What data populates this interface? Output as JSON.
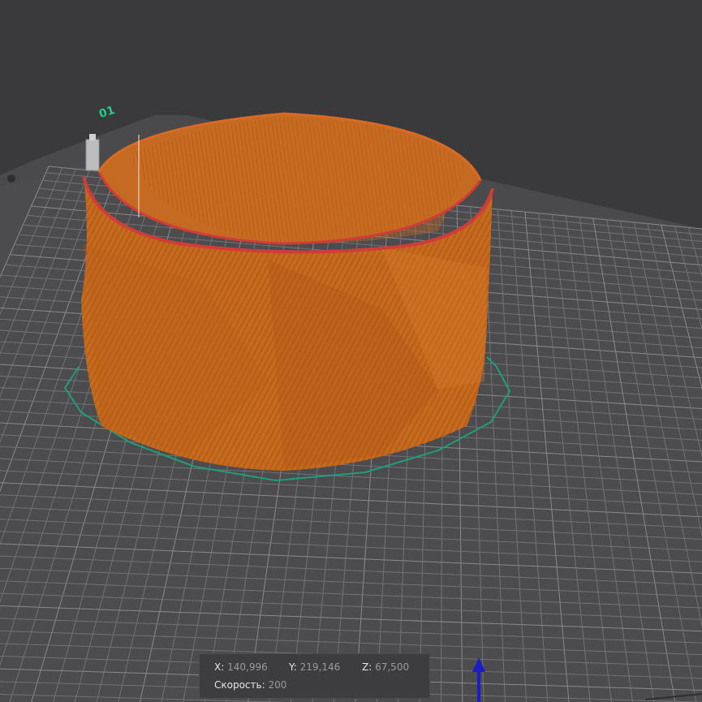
{
  "plate": {
    "label": "01"
  },
  "coords": {
    "x_label": "X:",
    "x_value": "140,996",
    "y_label": "Y:",
    "y_value": "219,146",
    "z_label": "Z:",
    "z_value": "67,500",
    "speed_label": "Скорость:",
    "speed_value": "200"
  },
  "colors": {
    "background": "#3a3a3c",
    "plate": "#4a4a4d",
    "grid": "#6e6e72",
    "model": "#c86a1e",
    "model_top_edge": "#d23c38",
    "outline": "#1f9e7a",
    "plate_label": "#27c98a",
    "axis_z": "#1c1cc8"
  },
  "icons": [
    "z-axis-arrow-icon",
    "nozzle-icon"
  ]
}
